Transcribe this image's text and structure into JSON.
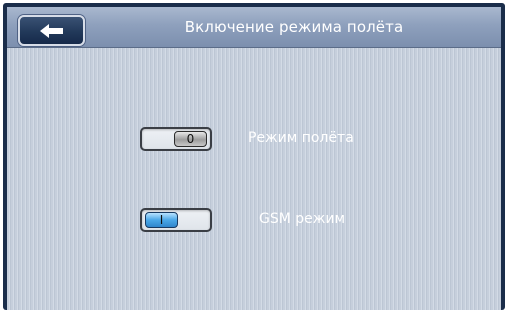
{
  "header": {
    "title": "Включение режима полёта",
    "back_icon": "back-arrow-icon"
  },
  "settings": [
    {
      "label": "Режим полёта",
      "toggle_text": "0",
      "state": "off"
    },
    {
      "label": "GSM режим",
      "toggle_text": "I",
      "state": "on"
    }
  ],
  "colors": {
    "header_bg": "#8ea0bd",
    "content_bg": "#c9d2de",
    "frame": "#1a2d4a",
    "toggle_on": "#4aa8e8",
    "toggle_off": "#9d9d9d",
    "text": "#ffffff"
  }
}
